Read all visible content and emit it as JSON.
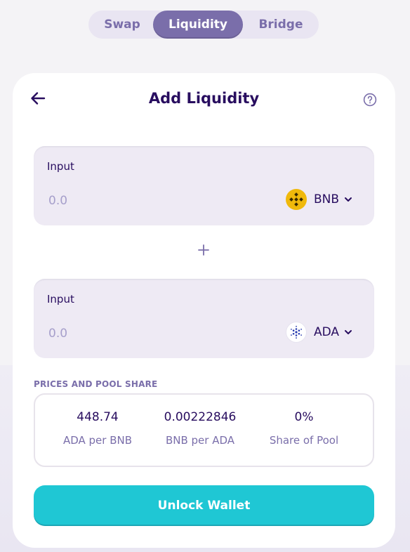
{
  "tabs": [
    {
      "label": "Swap"
    },
    {
      "label": "Liquidity"
    },
    {
      "label": "Bridge"
    }
  ],
  "card": {
    "title": "Add Liquidity",
    "back_icon": "arrow-left-icon",
    "help_icon": "question-circle-icon"
  },
  "inputs": [
    {
      "label": "Input",
      "placeholder": "0.0",
      "token": {
        "symbol": "BNB",
        "icon": "bnb-icon"
      }
    },
    {
      "label": "Input",
      "placeholder": "0.0",
      "token": {
        "symbol": "ADA",
        "icon": "ada-icon"
      }
    }
  ],
  "separator_icon": "plus-icon",
  "prices": {
    "section_title": "PRICES AND POOL SHARE",
    "items": [
      {
        "value": "448.74",
        "label": "ADA per BNB"
      },
      {
        "value": "0.00222846",
        "label": "BNB per ADA"
      },
      {
        "value": "0%",
        "label": "Share of Pool"
      }
    ]
  },
  "action": {
    "label": "Unlock Wallet"
  },
  "colors": {
    "primary": "#1fc7d4",
    "secondary": "#7a6eaa",
    "text": "#280d5f",
    "input_bg": "#eeeaf4"
  }
}
